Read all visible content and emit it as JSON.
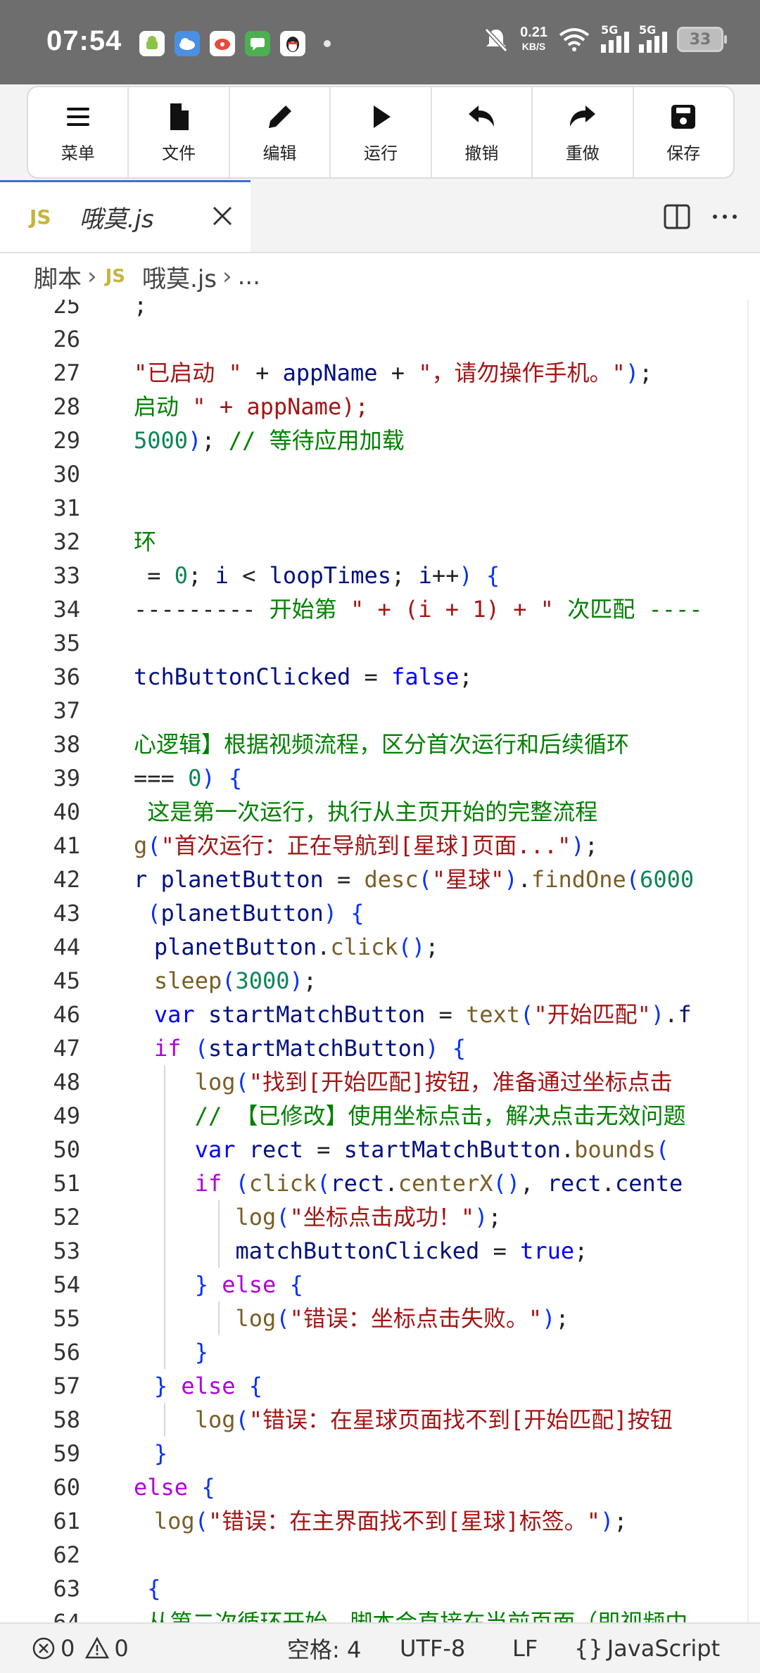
{
  "status_bar": {
    "time": "07:54",
    "apps": [
      {
        "icon": "android-app-icon",
        "color": "#8bc34a"
      },
      {
        "icon": "weather-cloud-icon",
        "color": "#4a90e2"
      },
      {
        "icon": "weibo-icon",
        "color": "#e84a3d"
      },
      {
        "icon": "message-icon",
        "color": "#4caf50"
      },
      {
        "icon": "qq-penguin-icon",
        "color": "#222222"
      }
    ],
    "net_speed": "0.21",
    "net_speed_unit": "KB/S",
    "sim1_label": "5G",
    "sim2_label": "5G",
    "battery": "33"
  },
  "toolbar": [
    {
      "label": "菜单",
      "icon": "menu-icon"
    },
    {
      "label": "文件",
      "icon": "file-icon"
    },
    {
      "label": "编辑",
      "icon": "pencil-icon"
    },
    {
      "label": "运行",
      "icon": "play-icon"
    },
    {
      "label": "撤销",
      "icon": "undo-icon"
    },
    {
      "label": "重做",
      "icon": "redo-icon"
    },
    {
      "label": "保存",
      "icon": "save-icon"
    }
  ],
  "tab": {
    "badge": "JS",
    "name": "哦莫.js"
  },
  "breadcrumb": {
    "root": "脚本",
    "badge": "JS",
    "file": "哦莫.js",
    "more": "..."
  },
  "editor": {
    "lines": [
      {
        "n": "25",
        "indent": 0,
        "code": ";",
        "guides": 0
      },
      {
        "n": "26",
        "indent": 0,
        "code": "",
        "guides": 0
      },
      {
        "n": "27",
        "indent": 0,
        "code": "\"已启动 \" + appName + \"，请勿操作手机。\");",
        "guides": 0
      },
      {
        "n": "28",
        "indent": 0,
        "code": "启动 \" + appName);",
        "guides": 0
      },
      {
        "n": "29",
        "indent": 0,
        "code": "5000); // 等待应用加载",
        "guides": 0
      },
      {
        "n": "30",
        "indent": 0,
        "code": "",
        "guides": 0
      },
      {
        "n": "31",
        "indent": 0,
        "code": "",
        "guides": 0
      },
      {
        "n": "32",
        "indent": 0,
        "code": "环",
        "guides": 0
      },
      {
        "n": "33",
        "indent": 0,
        "code": " = 0; i < loopTimes; i++) {",
        "guides": 0
      },
      {
        "n": "34",
        "indent": 0,
        "code": "--------- 开始第 \" + (i + 1) + \" 次匹配 ----",
        "guides": 0
      },
      {
        "n": "35",
        "indent": 0,
        "code": "",
        "guides": 0
      },
      {
        "n": "36",
        "indent": 0,
        "code": "tchButtonClicked = false;",
        "guides": 0
      },
      {
        "n": "37",
        "indent": 0,
        "code": "",
        "guides": 0
      },
      {
        "n": "38",
        "indent": 0,
        "code": "心逻辑】根据视频流程，区分首次运行和后续循环",
        "guides": 0
      },
      {
        "n": "39",
        "indent": 0,
        "code": "=== 0) {",
        "guides": 0
      },
      {
        "n": "40",
        "indent": 0,
        "code": " 这是第一次运行，执行从主页开始的完整流程",
        "guides": 0
      },
      {
        "n": "41",
        "indent": 0,
        "code": "g(\"首次运行：正在导航到[星球]页面...\");",
        "guides": 0
      },
      {
        "n": "42",
        "indent": 0,
        "code": "r planetButton = desc(\"星球\").findOne(6000",
        "guides": 0
      },
      {
        "n": "43",
        "indent": 0,
        "code": " (planetButton) {",
        "guides": 0
      },
      {
        "n": "44",
        "indent": 1,
        "code": "planetButton.click();",
        "guides": 0
      },
      {
        "n": "45",
        "indent": 1,
        "code": "sleep(3000);",
        "guides": 0
      },
      {
        "n": "46",
        "indent": 1,
        "code": "var startMatchButton = text(\"开始匹配\").f",
        "guides": 0
      },
      {
        "n": "47",
        "indent": 1,
        "code": "if (startMatchButton) {",
        "guides": 0
      },
      {
        "n": "48",
        "indent": 3,
        "code": "log(\"找到[开始匹配]按钮，准备通过坐标点击",
        "guides": 1
      },
      {
        "n": "49",
        "indent": 3,
        "code": "// 【已修改】使用坐标点击，解决点击无效问题",
        "guides": 1
      },
      {
        "n": "50",
        "indent": 3,
        "code": "var rect = startMatchButton.bounds(",
        "guides": 1
      },
      {
        "n": "51",
        "indent": 3,
        "code": "if (click(rect.centerX(), rect.cente",
        "guides": 1
      },
      {
        "n": "52",
        "indent": 5,
        "code": "log(\"坐标点击成功！\");",
        "guides": 2
      },
      {
        "n": "53",
        "indent": 5,
        "code": "matchButtonClicked = true;",
        "guides": 2
      },
      {
        "n": "54",
        "indent": 3,
        "code": "} else {",
        "guides": 1
      },
      {
        "n": "55",
        "indent": 5,
        "code": "log(\"错误：坐标点击失败。\");",
        "guides": 2
      },
      {
        "n": "56",
        "indent": 3,
        "code": "}",
        "guides": 1
      },
      {
        "n": "57",
        "indent": 1,
        "code": "} else {",
        "guides": 0
      },
      {
        "n": "58",
        "indent": 3,
        "code": "log(\"错误：在星球页面找不到[开始匹配]按钮",
        "guides": 1
      },
      {
        "n": "59",
        "indent": 1,
        "code": "}",
        "guides": 0
      },
      {
        "n": "60",
        "indent": 0,
        "code": "else {",
        "guides": 0
      },
      {
        "n": "61",
        "indent": 1,
        "code": "log(\"错误：在主界面找不到[星球]标签。\");",
        "guides": 0
      },
      {
        "n": "62",
        "indent": 0,
        "code": "",
        "guides": 0
      },
      {
        "n": "63",
        "indent": 0,
        "code": " {",
        "guides": 0
      },
      {
        "n": "64",
        "indent": 0,
        "code": " 从第二次循环开始，脚本会直接在当前页面（即视频中",
        "guides": 0
      }
    ]
  },
  "footer": {
    "errors": "0",
    "warnings": "0",
    "indent": "空格: 4",
    "encoding": "UTF-8",
    "eol": "LF",
    "language_icon": "{}",
    "language": "JavaScript"
  }
}
